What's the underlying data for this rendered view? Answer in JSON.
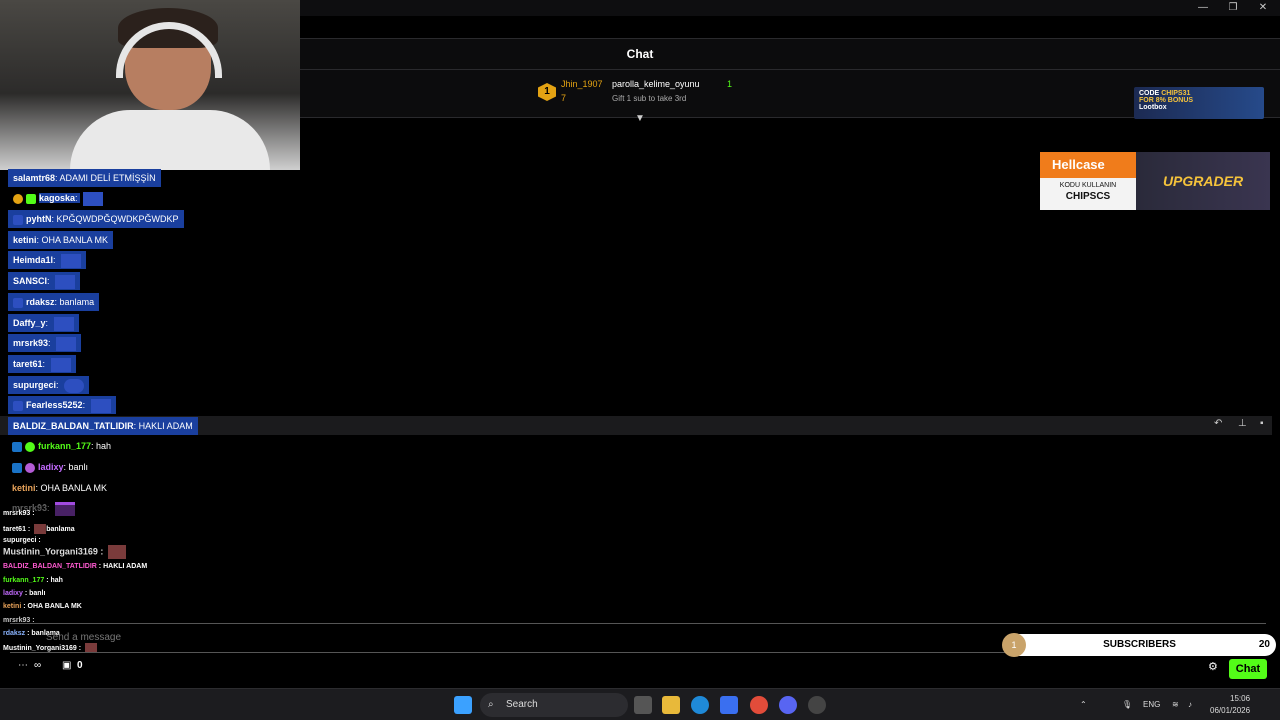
{
  "window": {
    "minimize": "—",
    "maximize": "❐",
    "close": "✕"
  },
  "chat": {
    "title": "Chat",
    "leaderboard": {
      "rank": "1",
      "first_user": "Jhin_1907",
      "first_count": "7",
      "second_user": "parolla_kelime_oyunu",
      "second_count": "1",
      "gift_prompt": "Gift 1 sub to take 3rd"
    }
  },
  "promo1": {
    "code_label": "CODE",
    "code": "CHIPS31",
    "bonus": "FOR 8% BONUS",
    "brand": "Lootbox"
  },
  "promo2": {
    "brand": "Hellcase",
    "use_label": "KODU KULLANIN",
    "code": "CHIPSCS",
    "cta": "UPGRADER"
  },
  "messages": [
    {
      "user": "salamtr68",
      "text": "ADAMI DELİ ETMİŞŞİN"
    },
    {
      "user": "kagoska",
      "text": ""
    },
    {
      "user": "pyhtN",
      "text": "KPĞQWDPĞQWDKPĞWDKP"
    },
    {
      "user": "ketini",
      "text": "OHA BANLA MK"
    },
    {
      "user": "Heimda1l",
      "text": ""
    },
    {
      "user": "SANSCI",
      "text": ""
    },
    {
      "user": "rdaksz",
      "text": "banlama"
    },
    {
      "user": "Daffy_y",
      "text": ""
    },
    {
      "user": "mrsrk93",
      "text": ""
    },
    {
      "user": "taret61",
      "text": ""
    },
    {
      "user": "supurgeci",
      "text": ""
    },
    {
      "user": "Fearless5252",
      "text": ""
    },
    {
      "user": "BALDIZ_BALDAN_TATLIDIR",
      "text": "HAKLI ADAM"
    },
    {
      "user": "furkann_177",
      "text": "hah"
    },
    {
      "user": "ladixy",
      "text": "banlı"
    },
    {
      "user": "ketini",
      "text": "OHA BANLA MK"
    },
    {
      "user": "mrsrk93",
      "text": ""
    }
  ],
  "overlay": [
    {
      "user": "mrsrk93",
      "text": ""
    },
    {
      "user": "taret61",
      "text": "banlama"
    },
    {
      "user": "supurgeci",
      "text": ""
    },
    {
      "user": "Mustinin_Yorgani3169",
      "text": ""
    },
    {
      "user": "BALDIZ_BALDAN_TATLIDIR",
      "text": "HAKLI ADAM"
    },
    {
      "user": "furkann_177",
      "text": "hah"
    },
    {
      "user": "ladixy",
      "text": "banlı"
    },
    {
      "user": "ketini",
      "text": "OHA BANLA MK"
    },
    {
      "user": "mrsrk93",
      "text": ""
    },
    {
      "user": "rdaksz",
      "text": "banlama"
    },
    {
      "user": "Mustinin_Yorgani3169",
      "text": ""
    }
  ],
  "colors": {
    "accent": "#53fc18",
    "highlight": "#1a3f9e",
    "gold": "#e4a313"
  },
  "input": {
    "placeholder": "Send a message"
  },
  "subscribers": {
    "badge": "1",
    "label": "SUBSCRIBERS",
    "count": "20"
  },
  "bottom": {
    "points": "0",
    "send": "Chat"
  },
  "taskbar": {
    "search": "Search",
    "lang": "ENG",
    "time": "15:06",
    "date": "06/01/2026"
  }
}
